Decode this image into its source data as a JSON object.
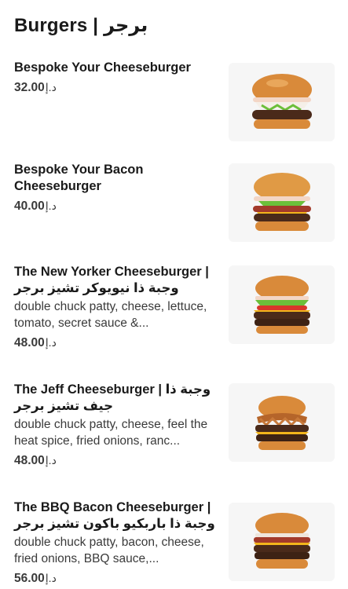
{
  "section": {
    "title": "Burgers | برجر"
  },
  "items": [
    {
      "name": "Bespoke Your Cheeseburger",
      "description": "",
      "price": "32.00",
      "currency": "د.إ"
    },
    {
      "name": "Bespoke Your Bacon Cheeseburger",
      "description": "",
      "price": "40.00",
      "currency": "د.إ"
    },
    {
      "name": "The New Yorker Cheeseburger | وجبة ذا نيويوكر تشيز برجر",
      "description": "double chuck patty, cheese, lettuce, tomato, secret sauce &...",
      "price": "48.00",
      "currency": "د.إ"
    },
    {
      "name": "The Jeff Cheeseburger | وجبة ذا جيف تشيز برجر",
      "description": "double chuck patty, cheese, feel the heat spice, fried onions, ranc...",
      "price": "48.00",
      "currency": "د.إ"
    },
    {
      "name": "The BBQ Bacon Cheeseburger | وجبة ذا باربكيو باكون تشيز برجر",
      "description": "double chuck patty, bacon, cheese, fried onions, BBQ sauce,...",
      "price": "56.00",
      "currency": "د.إ"
    }
  ],
  "colors": {
    "text": "#1a1a1a",
    "muted": "#3a3a3a",
    "bun": "#d98a3a",
    "patty": "#4a2a1a",
    "cheese": "#f2b51c",
    "lettuce": "#6cbf3a",
    "tomato": "#d8372a"
  },
  "icons": [
    "burger-image",
    "bacon-burger-image",
    "new-yorker-burger-image",
    "jeff-burger-image",
    "bbq-bacon-burger-image"
  ]
}
